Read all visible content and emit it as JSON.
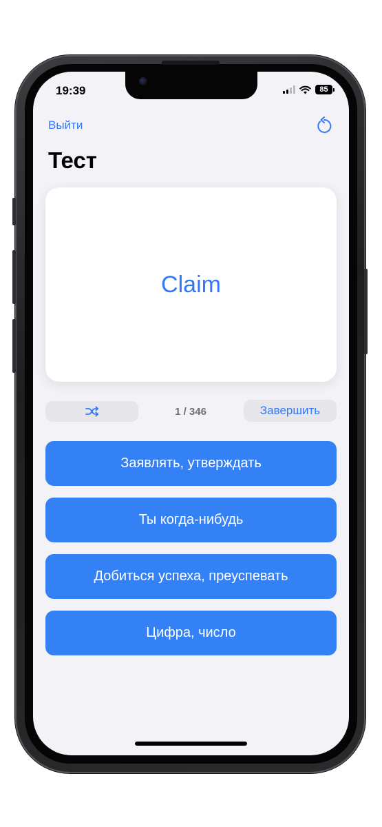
{
  "status_bar": {
    "time": "19:39",
    "battery": "85"
  },
  "nav": {
    "back_label": "Выйти",
    "reset_icon": "arrow-counterclockwise-icon"
  },
  "page": {
    "title": "Тест"
  },
  "card": {
    "word": "Claim"
  },
  "controls": {
    "shuffle_icon": "shuffle-icon",
    "counter": "1 / 346",
    "finish_label": "Завершить"
  },
  "answers": [
    "Заявлять, утверждать",
    "Ты когда-нибудь",
    "Добиться успеха, преуспевать",
    "Цифра, число"
  ],
  "colors": {
    "accent": "#3478f6",
    "answer_bg": "#3481f6",
    "screen_bg": "#f2f2f7"
  }
}
